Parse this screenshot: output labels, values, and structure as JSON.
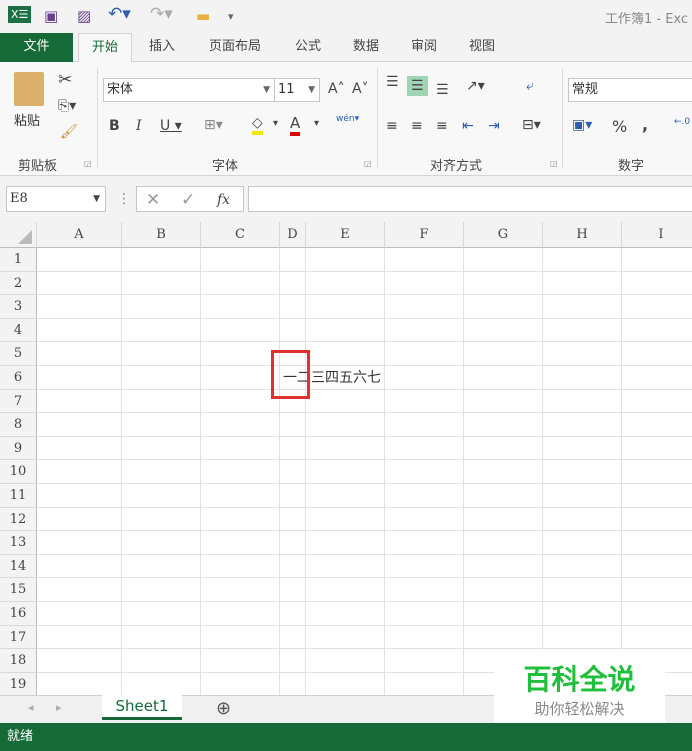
{
  "title": "工作簿1 - Exc",
  "tabs": [
    "文件",
    "开始",
    "插入",
    "页面布局",
    "公式",
    "数据",
    "审阅",
    "视图"
  ],
  "ribbon": {
    "paste": "粘贴",
    "font_name": "宋体",
    "font_size": "11",
    "number_format": "常规",
    "groups": [
      "剪贴板",
      "字体",
      "对齐方式",
      "数字"
    ],
    "percent": "%",
    "comma": ",",
    "phonetic": "wén"
  },
  "formula": {
    "name_box": "E8",
    "fx": "fx",
    "value": ""
  },
  "columns": [
    "A",
    "B",
    "C",
    "D",
    "E",
    "F",
    "G",
    "H",
    "I"
  ],
  "rows": [
    "1",
    "2",
    "3",
    "4",
    "5",
    "6",
    "7",
    "8",
    "9",
    "10",
    "11",
    "12",
    "13",
    "14",
    "15",
    "16",
    "17",
    "18",
    "19"
  ],
  "cell_text": "一二三四五六七",
  "sheet_tab": "Sheet1",
  "status": "就绪",
  "watermark": {
    "title": "百科全说",
    "subtitle": "助你轻松解决"
  },
  "colors": {
    "green": "#166a38",
    "highlight": "#e03030"
  }
}
